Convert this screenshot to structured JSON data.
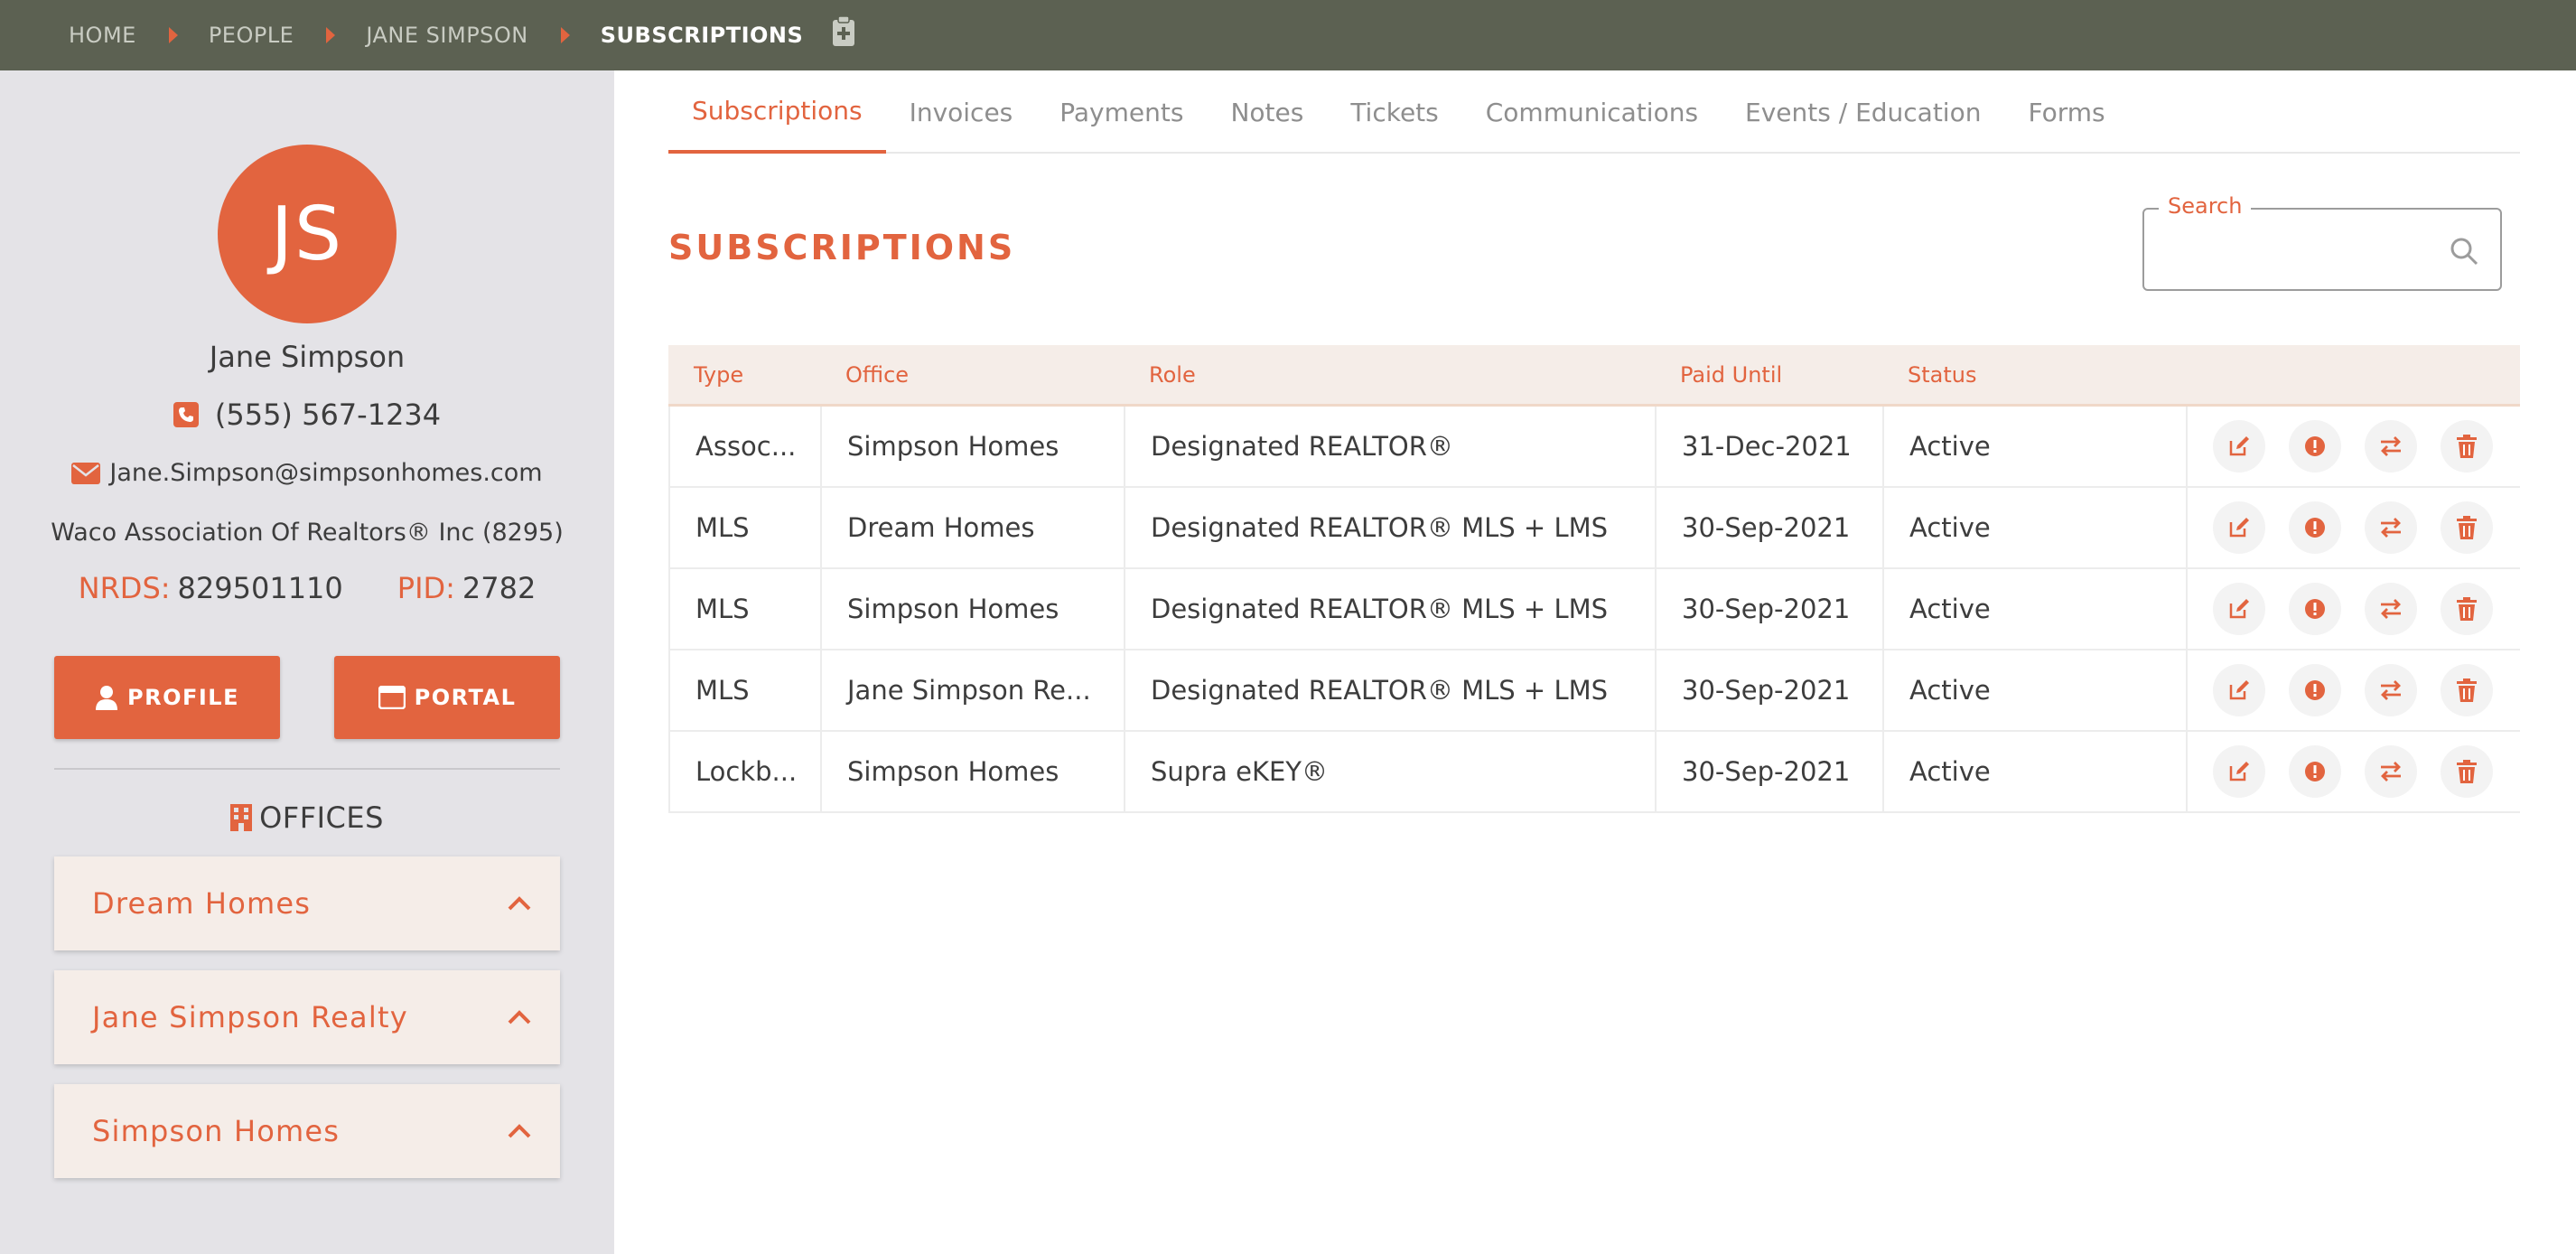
{
  "breadcrumb": {
    "items": [
      "HOME",
      "PEOPLE",
      "JANE SIMPSON"
    ],
    "current": "SUBSCRIPTIONS"
  },
  "profile": {
    "initials": "JS",
    "name": "Jane Simpson",
    "phone": "(555) 567-1234",
    "email": "Jane.Simpson@simpsonhomes.com",
    "association": "Waco Association Of Realtors® Inc (8295)",
    "nrds_label": "NRDS:",
    "nrds_value": "829501110",
    "pid_label": "PID:",
    "pid_value": "2782",
    "profile_button": "PROFILE",
    "portal_button": "PORTAL"
  },
  "offices": {
    "title": "OFFICES",
    "items": [
      "Dream Homes",
      "Jane Simpson Realty",
      "Simpson Homes"
    ]
  },
  "tabs": [
    "Subscriptions",
    "Invoices",
    "Payments",
    "Notes",
    "Tickets",
    "Communications",
    "Events / Education",
    "Forms"
  ],
  "active_tab": "Subscriptions",
  "section_title": "SUBSCRIPTIONS",
  "search": {
    "label": "Search",
    "value": ""
  },
  "table": {
    "headers": [
      "Type",
      "Office",
      "Role",
      "Paid Until",
      "Status"
    ],
    "rows": [
      [
        "Assoc...",
        "Simpson Homes",
        "Designated REALTOR®",
        "31-Dec-2021",
        "Active"
      ],
      [
        "MLS",
        "Dream Homes",
        "Designated REALTOR® MLS + LMS",
        "30-Sep-2021",
        "Active"
      ],
      [
        "MLS",
        "Simpson Homes",
        "Designated REALTOR® MLS + LMS",
        "30-Sep-2021",
        "Active"
      ],
      [
        "MLS",
        "Jane Simpson Re...",
        "Designated REALTOR® MLS + LMS",
        "30-Sep-2021",
        "Active"
      ],
      [
        "Lockb...",
        "Simpson Homes",
        "Supra eKEY®",
        "30-Sep-2021",
        "Active"
      ]
    ],
    "row_actions": [
      "edit-icon",
      "alert-icon",
      "transfer-icon",
      "trash-icon"
    ]
  },
  "colors": {
    "accent": "#e2643f",
    "topbar": "#5c6152",
    "sidebar": "#e4e3e7",
    "card": "#f5ede8"
  }
}
